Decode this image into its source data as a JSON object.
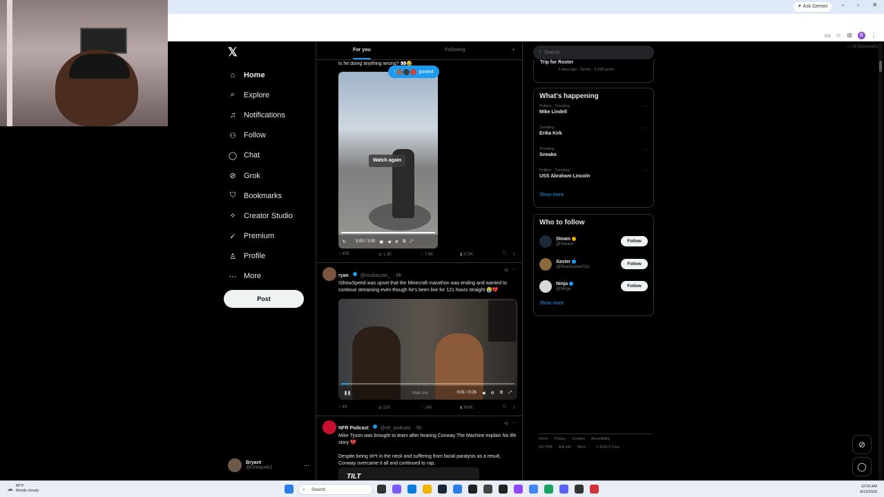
{
  "browser": {
    "gemini_label": "✦ Ask Gemini",
    "bookmarks_label": "All Bookmarks",
    "profile_initial": "B"
  },
  "nav": {
    "items": [
      {
        "label": "Home",
        "icon": "⌂"
      },
      {
        "label": "Explore",
        "icon": "⌕"
      },
      {
        "label": "Notifications",
        "icon": "♫"
      },
      {
        "label": "Follow",
        "icon": "⚇"
      },
      {
        "label": "Chat",
        "icon": "◯"
      },
      {
        "label": "Grok",
        "icon": "⊘"
      },
      {
        "label": "Bookmarks",
        "icon": "⛉"
      },
      {
        "label": "Creator Studio",
        "icon": "✧"
      },
      {
        "label": "Premium",
        "icon": "✓"
      },
      {
        "label": "Profile",
        "icon": "♙"
      },
      {
        "label": "More",
        "icon": "⋯"
      }
    ],
    "post_label": "Post"
  },
  "account": {
    "name": "Bryant",
    "handle": "@Uniiqueb1"
  },
  "timeline": {
    "tabs": [
      "For you",
      "Following"
    ],
    "posted_label": "posted",
    "tweet1": {
      "text": "Is he doing anything wrong? 👀😂",
      "watch_again": "Watch again",
      "time": "3:00 / 3:00",
      "replies": "408",
      "reposts": "1.3K",
      "likes": "7.9K",
      "views": "373K"
    },
    "tweet2": {
      "name": "ryan",
      "handle": "@scubaryan_",
      "time": "· 8h",
      "text": "IShowSpeed was upset that the Minecraft marathon was ending and wanted to continue streaming even though he's been live for 121 hours straight 😭💔",
      "video_time": "0:01 / 0:26",
      "subtitle": "Yeah bro",
      "progress": 0.04,
      "replies": "49",
      "reposts": "216",
      "likes": "14K",
      "views": "360K"
    },
    "tweet3": {
      "name": "NFR Podcast",
      "handle": "@nfr_podcast",
      "time": "· 5h",
      "text1": "Mike Tyson was brought to tears after hearing Conway The Machine explain his life story 💔",
      "text2": "Despite being sh*t in the neck and suffering from facial paralysis as a result, Conway overcame it all and continued to rap.",
      "media_label": "TILT"
    }
  },
  "right": {
    "search_placeholder": "Search",
    "trip": {
      "title": "Trip for Roster",
      "meta": "2 days ago · Sports · 5,228 posts"
    },
    "happening_title": "What's happening",
    "trends": [
      {
        "category": "Politics · Trending",
        "title": "Mike Lindell"
      },
      {
        "category": "Trending",
        "title": "Erika Kirk"
      },
      {
        "category": "Trending",
        "title": "Sneako"
      },
      {
        "category": "Politics · Trending",
        "title": "USS Abraham Lincoln"
      }
    ],
    "show_more": "Show more",
    "who_title": "Who to follow",
    "who": [
      {
        "name": "Steam",
        "handle": "@Steam",
        "follow": "Follow",
        "color": "#1b2838"
      },
      {
        "name": "Xavier",
        "handle": "@RealXavier011",
        "follow": "Follow",
        "color": "#8a6a3c"
      },
      {
        "name": "Ninja",
        "handle": "@Ninja",
        "follow": "Follow",
        "color": "#d9d9d9"
      }
    ],
    "footer": [
      "Terms",
      "Privacy",
      "Cookies",
      "Accessibility",
      "US TIDA",
      "Ads info",
      "More ···",
      "© 2026 X Corp."
    ]
  },
  "taskbar": {
    "temp": "80°F",
    "weather": "Mostly cloudy",
    "search": "Search",
    "time": "12:00 AM",
    "date": "8/13/2026"
  }
}
